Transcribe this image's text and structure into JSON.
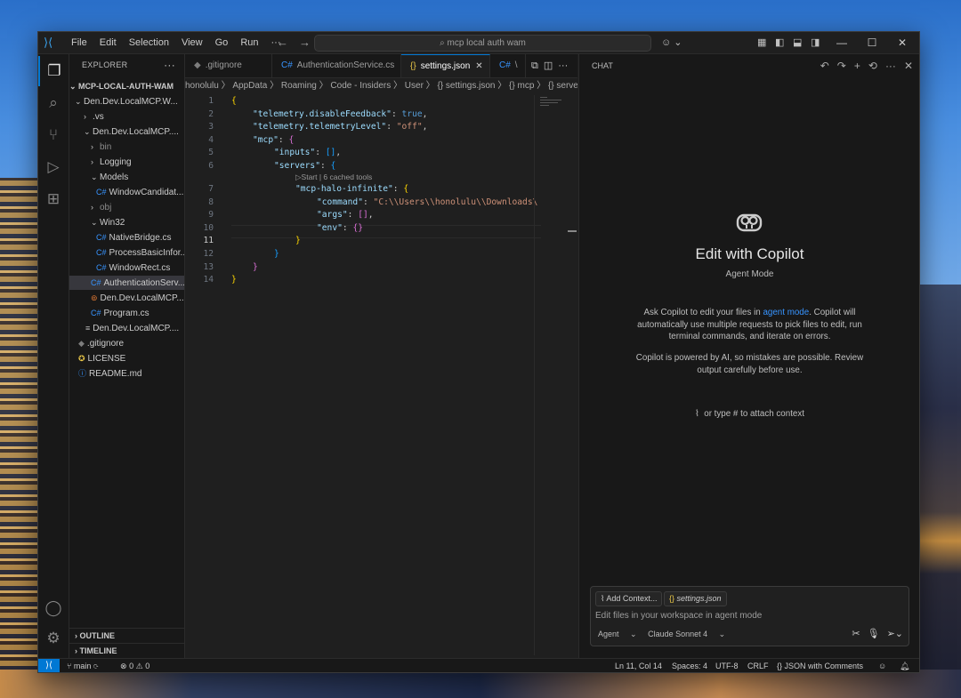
{
  "menu": [
    "File",
    "Edit",
    "Selection",
    "View",
    "Go",
    "Run",
    "···"
  ],
  "search": {
    "text": "mcp local auth wam"
  },
  "explorer": {
    "header": "EXPLORER",
    "root": "MCP-LOCAL-AUTH-WAM",
    "items": [
      {
        "label": "Den.Dev.LocalMCP.W..."
      },
      {
        "label": ".vs"
      },
      {
        "label": "Den.Dev.LocalMCP...."
      },
      {
        "label": "bin"
      },
      {
        "label": "Logging"
      },
      {
        "label": "Models"
      },
      {
        "label": "WindowCandidat..."
      },
      {
        "label": "obj"
      },
      {
        "label": "Win32"
      },
      {
        "label": "NativeBridge.cs"
      },
      {
        "label": "ProcessBasicInfor..."
      },
      {
        "label": "WindowRect.cs"
      },
      {
        "label": "AuthenticationServ..."
      },
      {
        "label": "Den.Dev.LocalMCP..."
      },
      {
        "label": "Program.cs"
      },
      {
        "label": "Den.Dev.LocalMCP...."
      },
      {
        "label": ".gitignore"
      },
      {
        "label": "LICENSE"
      },
      {
        "label": "README.md"
      }
    ],
    "outline": "OUTLINE",
    "timeline": "TIMELINE"
  },
  "tabs": [
    {
      "label": ".gitignore"
    },
    {
      "label": "AuthenticationService.cs"
    },
    {
      "label": "settings.json"
    },
    {
      "label": "\\"
    }
  ],
  "breadcrumbs": "honolulu 〉 AppData 〉 Roaming 〉 Code - Insiders 〉 User 〉 {} settings.json 〉 {} mcp 〉 {} servers 〉",
  "code": {
    "line_numbers": [
      "1",
      "2",
      "3",
      "4",
      "5",
      "6",
      "7",
      "8",
      "9",
      "10",
      "11",
      "12",
      "13",
      "14"
    ],
    "lens": "▷Start | 6 cached tools",
    "l1": "{",
    "l2k": "\"telemetry.disableFeedback\"",
    "l2v": "true",
    "l3k": "\"telemetry.telemetryLevel\"",
    "l3v": "\"off\"",
    "l4k": "\"mcp\"",
    "l4b": "{",
    "l5k": "\"inputs\"",
    "l5b": "[]",
    "l6k": "\"servers\"",
    "l6b": "{",
    "l7k": "\"mcp-halo-infinite\"",
    "l7b": "{",
    "l8k": "\"command\"",
    "l8v": "\"C:\\\\Users\\\\honolulu\\\\Downloads\\",
    "l9k": "\"args\"",
    "l9b": "[]",
    "l10k": "\"env\"",
    "l10b": "{}",
    "l11": "}",
    "l12": "}",
    "l13": "}",
    "l14": "}"
  },
  "chat": {
    "header": "CHAT",
    "title": "Edit with Copilot",
    "subtitle": "Agent Mode",
    "p1_pre": "Ask Copilot to edit your files in ",
    "p1_link": "agent mode",
    "p1_post": ". Copilot will automatically use multiple requests to pick files to edit, run terminal commands, and iterate on errors.",
    "p2": "Copilot is powered by AI, so mistakes are possible. Review output carefully before use.",
    "hint": "or type # to attach context",
    "add_context": "Add Context...",
    "file_chip": "settings.json",
    "placeholder": "Edit files in your workspace in agent mode",
    "mode": "Agent",
    "model": "Claude Sonnet 4"
  },
  "status": {
    "branch": "main",
    "problems": "0",
    "warnings": "0",
    "position": "Ln 11, Col 14",
    "spaces": "Spaces: 4",
    "encoding": "UTF-8",
    "eol": "CRLF",
    "language": "JSON with Comments"
  }
}
